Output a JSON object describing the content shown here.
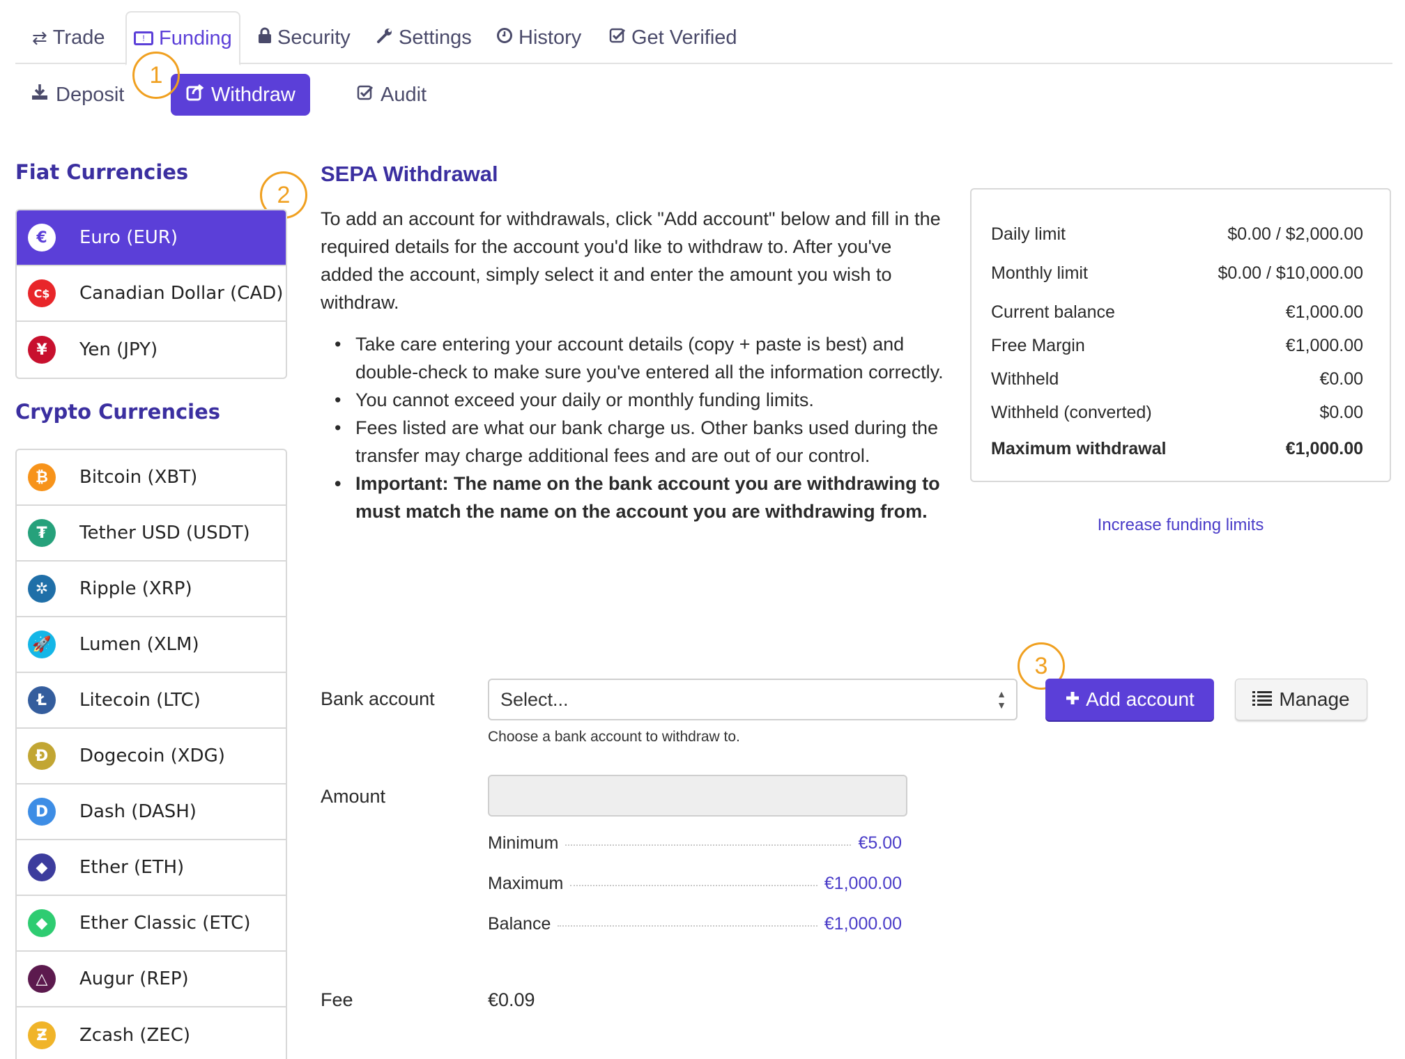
{
  "top_tabs": [
    {
      "label": "Trade",
      "icon": "retweet-icon",
      "glyph": "⇄",
      "active": false
    },
    {
      "label": "Funding",
      "icon": "money-icon",
      "glyph": "💵",
      "active": true
    },
    {
      "label": "Security",
      "icon": "lock-icon",
      "glyph": "🔒",
      "active": false
    },
    {
      "label": "Settings",
      "icon": "wrench-icon",
      "glyph": "🔧",
      "active": false
    },
    {
      "label": "History",
      "icon": "clock-icon",
      "glyph": "◷",
      "active": false
    },
    {
      "label": "Get Verified",
      "icon": "check-square-icon",
      "glyph": "☑",
      "active": false
    }
  ],
  "sub_tabs": [
    {
      "label": "Deposit",
      "icon": "download-icon",
      "glyph": "⤓",
      "active": false
    },
    {
      "label": "Withdraw",
      "icon": "share-icon",
      "glyph": "↗",
      "active": true
    },
    {
      "label": "Audit",
      "icon": "check-square-icon",
      "glyph": "☑",
      "active": false
    }
  ],
  "annotations": [
    "1",
    "2",
    "3"
  ],
  "sidebar": {
    "fiat_heading": "Fiat Currencies",
    "fiat": [
      {
        "label": "Euro (EUR)",
        "icon": "euro-icon",
        "glyph": "€",
        "color": "#5b3fd8",
        "active": true
      },
      {
        "label": "Canadian Dollar (CAD)",
        "icon": "cad-icon",
        "glyph": "C$",
        "color": "#e8262a",
        "active": false
      },
      {
        "label": "Yen (JPY)",
        "icon": "yen-icon",
        "glyph": "¥",
        "color": "#c8102e",
        "active": false
      }
    ],
    "crypto_heading": "Crypto Currencies",
    "crypto": [
      {
        "label": "Bitcoin (XBT)",
        "icon": "bitcoin-icon",
        "glyph": "₿",
        "color": "#f7931a"
      },
      {
        "label": "Tether USD (USDT)",
        "icon": "tether-icon",
        "glyph": "₮",
        "color": "#26a17b"
      },
      {
        "label": "Ripple (XRP)",
        "icon": "ripple-icon",
        "glyph": "✲",
        "color": "#1f6fa8"
      },
      {
        "label": "Lumen (XLM)",
        "icon": "stellar-rocket-icon",
        "glyph": "🚀",
        "color": "#14b6e7"
      },
      {
        "label": "Litecoin (LTC)",
        "icon": "litecoin-icon",
        "glyph": "Ł",
        "color": "#345d9d"
      },
      {
        "label": "Dogecoin (XDG)",
        "icon": "dogecoin-icon",
        "glyph": "Ð",
        "color": "#c2a633"
      },
      {
        "label": "Dash (DASH)",
        "icon": "dash-icon",
        "glyph": "D",
        "color": "#3d8de5"
      },
      {
        "label": "Ether (ETH)",
        "icon": "ethereum-icon",
        "glyph": "◆",
        "color": "#3c3c9d"
      },
      {
        "label": "Ether Classic (ETC)",
        "icon": "ethereum-classic-icon",
        "glyph": "◆",
        "color": "#2ecc71"
      },
      {
        "label": "Augur (REP)",
        "icon": "augur-icon",
        "glyph": "△",
        "color": "#5c1a4e"
      },
      {
        "label": "Zcash (ZEC)",
        "icon": "zcash-icon",
        "glyph": "Ƶ",
        "color": "#f0b429"
      }
    ]
  },
  "main": {
    "title": "SEPA Withdrawal",
    "intro": "To add an account for withdrawals, click \"Add account\" below and fill in the required details for the account you'd like to withdraw to. After you've added the account, simply select it and enter the amount you wish to withdraw.",
    "bullets": [
      {
        "text": "Take care entering your account details (copy + paste is best) and double-check to make sure you've entered all the information correctly.",
        "strong": false
      },
      {
        "text": "You cannot exceed your daily or monthly funding limits.",
        "strong": false
      },
      {
        "text": "Fees listed are what our bank charge us. Other banks used during the transfer may charge additional fees and are out of our control.",
        "strong": false
      },
      {
        "text": "Important: The name on the bank account you are withdrawing to must match the name on the account you are withdrawing from.",
        "strong": true
      }
    ]
  },
  "limits": {
    "rows": [
      {
        "label": "Daily limit",
        "value": "$0.00 / $2,000.00"
      },
      {
        "label": "Monthly limit",
        "value": "$0.00 / $10,000.00"
      },
      {
        "label": "Current balance",
        "value": "€1,000.00"
      },
      {
        "label": "Free Margin",
        "value": "€1,000.00"
      },
      {
        "label": "Withheld",
        "value": "€0.00"
      },
      {
        "label": "Withheld (converted)",
        "value": "$0.00"
      }
    ],
    "max_label": "Maximum withdrawal",
    "max_value": "€1,000.00",
    "increase_link": "Increase funding limits"
  },
  "form": {
    "bank_label": "Bank account",
    "bank_placeholder": "Select...",
    "bank_help": "Choose a bank account to withdraw to.",
    "add_account": "Add account",
    "manage": "Manage",
    "amount_label": "Amount",
    "amount_value": "",
    "stats": [
      {
        "label": "Minimum",
        "value": "€5.00"
      },
      {
        "label": "Maximum",
        "value": "€1,000.00"
      },
      {
        "label": "Balance",
        "value": "€1,000.00"
      }
    ],
    "fee_label": "Fee",
    "fee_value": "€0.09"
  },
  "colors": {
    "accent": "#5b3fd8",
    "heading": "#3b2fa0",
    "link": "#4a3cc8",
    "annotation": "#f0a020"
  }
}
